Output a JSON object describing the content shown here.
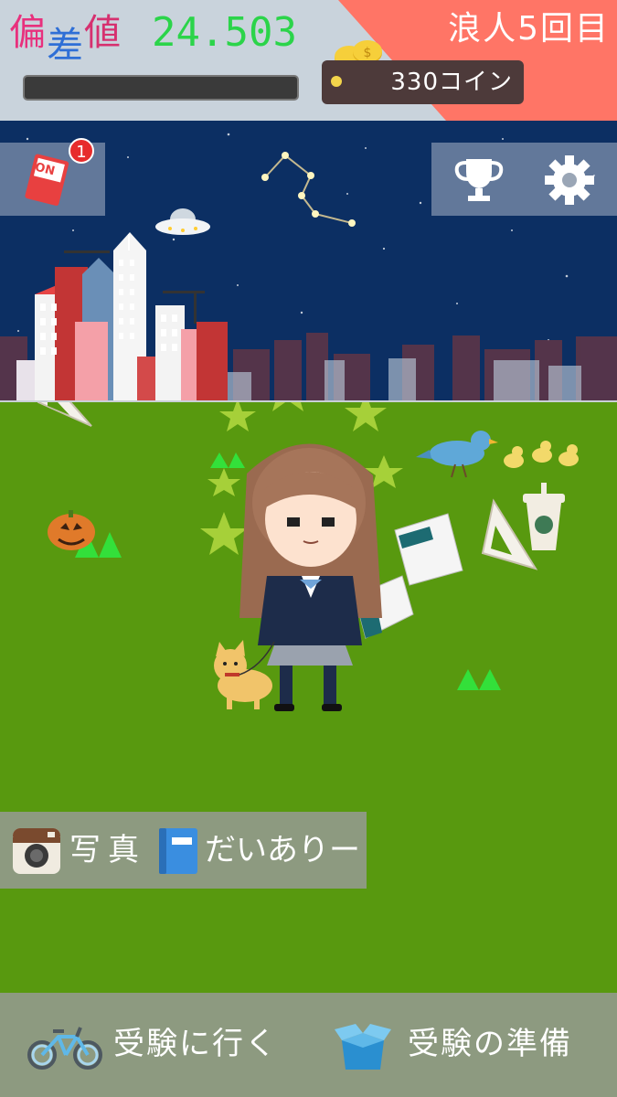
{
  "header": {
    "deviation_label_1": "偏",
    "deviation_label_2": "差",
    "deviation_label_3": "値",
    "deviation_value": "24.503",
    "progress": 0,
    "coins": "330コイン",
    "ronin_label": "浪人5回目"
  },
  "top_buttons": {
    "notify_badge": "1",
    "notify_toggle": "ON",
    "trophy_icon": "trophy-icon",
    "settings_icon": "gear-icon"
  },
  "mid_menu": {
    "photo_label": "写真",
    "diary_label": "だいありー"
  },
  "bottom_bar": {
    "go_exam_label": "受験に行く",
    "prepare_label": "受験の準備"
  },
  "colors": {
    "sky": "#0c2f63",
    "grass": "#58990f",
    "accent": "#ff7566",
    "panel": "#8d9a80"
  }
}
